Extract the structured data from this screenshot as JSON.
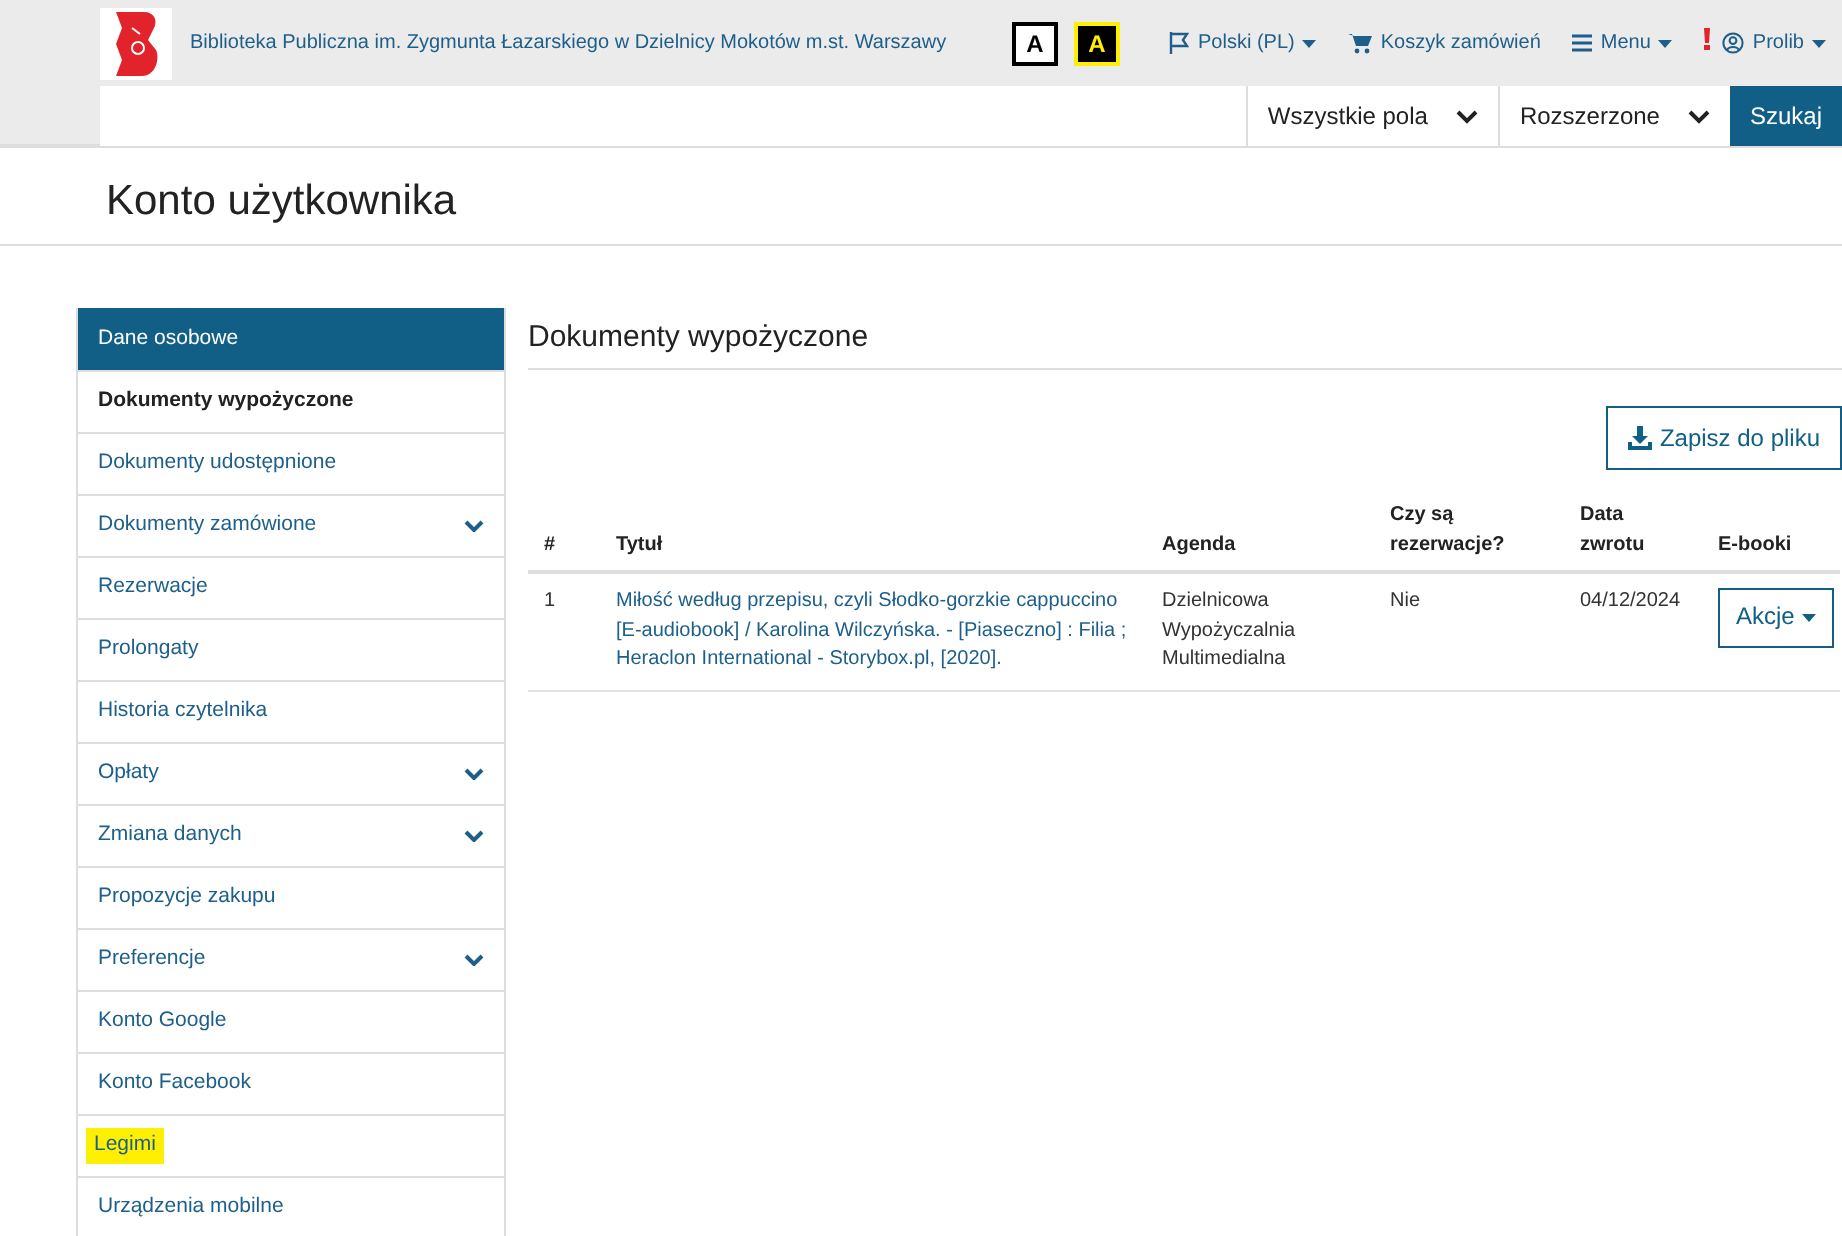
{
  "header": {
    "library_name": "Biblioteka Publiczna im. Zygmunta Łazarskiego w Dzielnicy Mokotów m.st. Warszawy",
    "contrast_buttons": [
      {
        "label": "A",
        "kind": "normal"
      },
      {
        "label": "A",
        "kind": "high"
      }
    ],
    "nav": [
      {
        "label": "Polski (PL)",
        "kind": "flag",
        "dropdown": true
      },
      {
        "label": "Koszyk zamówień",
        "kind": "cart",
        "dropdown": false
      },
      {
        "label": "Menu",
        "kind": "menu",
        "dropdown": true
      },
      {
        "label": "Prolib",
        "kind": "user",
        "dropdown": true
      }
    ]
  },
  "search": {
    "field_selector": "Wszystkie pola",
    "mode_selector": "Rozszerzone",
    "button": "Szukaj"
  },
  "page_title": "Konto użytkownika",
  "sidebar": {
    "items": [
      {
        "label": "Dane osobowe",
        "kind": "header",
        "selected": false,
        "has_submenu": false,
        "marked": false
      },
      {
        "label": "Dokumenty wypożyczone",
        "kind": "link",
        "selected": true,
        "has_submenu": false,
        "marked": false
      },
      {
        "label": "Dokumenty udostępnione",
        "kind": "link",
        "selected": false,
        "has_submenu": false,
        "marked": false
      },
      {
        "label": "Dokumenty zamówione",
        "kind": "link",
        "selected": false,
        "has_submenu": true,
        "marked": false
      },
      {
        "label": "Rezerwacje",
        "kind": "link",
        "selected": false,
        "has_submenu": false,
        "marked": false
      },
      {
        "label": "Prolongaty",
        "kind": "link",
        "selected": false,
        "has_submenu": false,
        "marked": false
      },
      {
        "label": "Historia czytelnika",
        "kind": "link",
        "selected": false,
        "has_submenu": false,
        "marked": false
      },
      {
        "label": "Opłaty",
        "kind": "link",
        "selected": false,
        "has_submenu": true,
        "marked": false
      },
      {
        "label": "Zmiana danych",
        "kind": "link",
        "selected": false,
        "has_submenu": true,
        "marked": false
      },
      {
        "label": "Propozycje zakupu",
        "kind": "link",
        "selected": false,
        "has_submenu": false,
        "marked": false
      },
      {
        "label": "Preferencje",
        "kind": "link",
        "selected": false,
        "has_submenu": true,
        "marked": false
      },
      {
        "label": "Konto Google",
        "kind": "link",
        "selected": false,
        "has_submenu": false,
        "marked": false
      },
      {
        "label": "Konto Facebook",
        "kind": "link",
        "selected": false,
        "has_submenu": false,
        "marked": false
      },
      {
        "label": "Legimi",
        "kind": "link",
        "selected": false,
        "has_submenu": false,
        "marked": true
      },
      {
        "label": "Urządzenia mobilne",
        "kind": "link",
        "selected": false,
        "has_submenu": false,
        "marked": false
      }
    ]
  },
  "content": {
    "title": "Dokumenty wypożyczone",
    "save_button": "Zapisz do pliku",
    "table": {
      "columns": [
        "#",
        "Tytuł",
        "Agenda",
        "Czy są rezerwacje?",
        "Data zwrotu",
        "E-booki"
      ],
      "rows": [
        {
          "number": "1",
          "title": "Miłość według przepisu, czyli Słodko-gorzkie cappuccino [E-audiobook] / Karolina Wilczyńska. - [Piaseczno] : Filia ; Heraclon International - Storybox.pl, [2020].",
          "agenda": "Dzielnicowa Wypożyczalnia Multimedialna",
          "reservations": "Nie",
          "due_date": "04/12/2024",
          "action": "Akcje"
        }
      ]
    }
  }
}
